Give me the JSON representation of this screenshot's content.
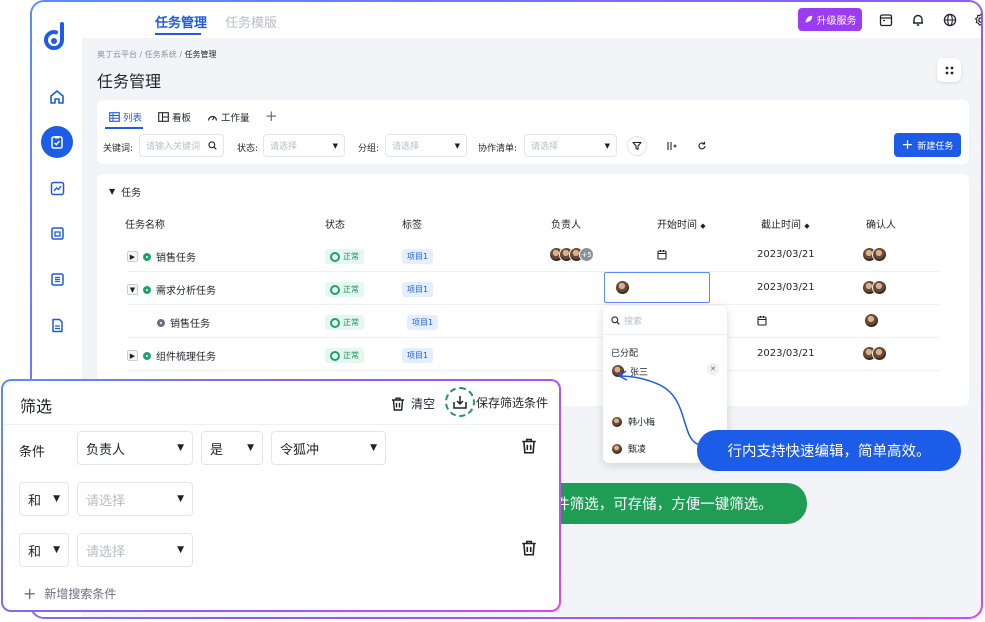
{
  "topbar": {
    "tabs": [
      {
        "label": "任务管理",
        "active": true
      },
      {
        "label": "任务模版",
        "active": false
      }
    ],
    "upgrade_label": "升级服务"
  },
  "breadcrumb": {
    "parts": [
      "奥丁云平台 / 任务系统 / "
    ],
    "current": "任务管理"
  },
  "page_title": "任务管理",
  "view_tabs": [
    {
      "label": "列表",
      "active": true
    },
    {
      "label": "看板"
    },
    {
      "label": "工作量"
    }
  ],
  "add_view": "+",
  "filters": {
    "keyword_label": "关键词:",
    "keyword_placeholder": "请输入关键词",
    "status_label": "状态:",
    "status_placeholder": "请选择",
    "group_label": "分组:",
    "group_placeholder": "请选择",
    "list_label": "协作清单:",
    "list_placeholder": "请选择"
  },
  "new_task_label": "新建任务",
  "group_title": "任务",
  "columns": [
    "任务名称",
    "状态",
    "标签",
    "负责人",
    "开始时间",
    "截止时间",
    "确认人"
  ],
  "rows": [
    {
      "name": "销售任务",
      "status": "正常",
      "tag": "项目1",
      "end": "2023/03/21",
      "assignee_extra": "+5"
    },
    {
      "name": "需求分析任务",
      "status": "正常",
      "tag": "项目1",
      "end": "2023/03/21"
    },
    {
      "name": "销售任务",
      "status": "正常",
      "tag": "项目1",
      "end": ""
    },
    {
      "name": "组件梳理任务",
      "status": "正常",
      "tag": "项目1",
      "end": "2023/03/21"
    }
  ],
  "popup": {
    "search_placeholder": "搜索",
    "assigned_label": "已分配",
    "assigned": "张三",
    "others": [
      "韩小梅",
      "甄凌"
    ]
  },
  "callouts": {
    "blue": "行内支持快速编辑，简单高效。",
    "green": "自定义条件筛选，可存储，方便一键筛选。"
  },
  "filter_panel": {
    "title": "筛选",
    "clear_label": "清空",
    "save_label": "保存筛选条件",
    "condition_label": "条件",
    "row1": {
      "field": "负责人",
      "op": "是",
      "value": "令狐冲"
    },
    "and_label": "和",
    "placeholder": "请选择",
    "add_label": "新增搜索条件"
  },
  "colors": {
    "primary": "#1d5ce6",
    "upgrade": "#9b3cf0",
    "success": "#1f9d55"
  }
}
